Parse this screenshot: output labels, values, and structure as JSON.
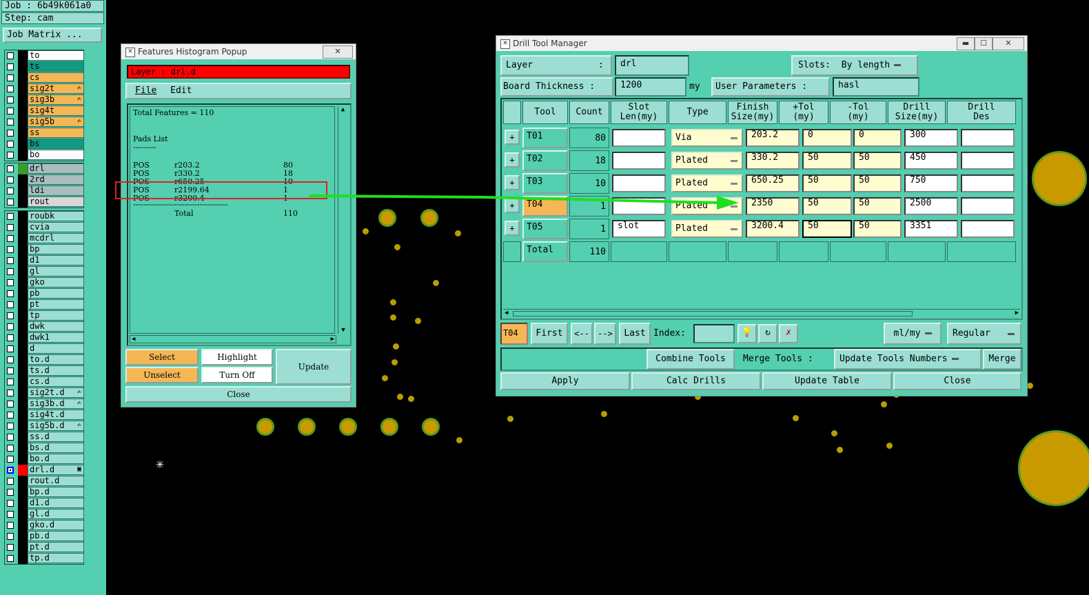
{
  "job_info": {
    "job": "Job : 6b49k061a0",
    "step": "Step: cam",
    "job_matrix": "Job Matrix ..."
  },
  "layers_top": [
    {
      "name": "to",
      "color": "#ffffff"
    },
    {
      "name": "ts",
      "color": "#129a83"
    },
    {
      "name": "cs",
      "color": "#f5b756"
    },
    {
      "name": "sig2t",
      "color": "#f5b756",
      "tick": true
    },
    {
      "name": "sig3b",
      "color": "#f5b756",
      "tick": true
    },
    {
      "name": "sig4t",
      "color": "#f5b756"
    },
    {
      "name": "sig5b",
      "color": "#f5b756",
      "tick": true
    },
    {
      "name": "ss",
      "color": "#f5b756"
    },
    {
      "name": "bs",
      "color": "#129a83"
    },
    {
      "name": "bo",
      "color": "#ffffff"
    }
  ],
  "layers_mid": [
    {
      "name": "drl",
      "color": "#a9bfbf",
      "swatch": "#3a9a2a"
    },
    {
      "name": "2rd",
      "color": "#a9bfbf"
    },
    {
      "name": "ldi",
      "color": "#a9bfbf"
    },
    {
      "name": "rout",
      "color": "#d8d8d8"
    }
  ],
  "layers_bottom": [
    {
      "name": "roubk"
    },
    {
      "name": "cvia"
    },
    {
      "name": "mcdrl"
    },
    {
      "name": "bp"
    },
    {
      "name": "d1"
    },
    {
      "name": "gl"
    },
    {
      "name": "gko"
    },
    {
      "name": "pb"
    },
    {
      "name": "pt"
    },
    {
      "name": "tp"
    },
    {
      "name": "dwk"
    },
    {
      "name": "dwk1"
    },
    {
      "name": "d"
    },
    {
      "name": "to.d"
    },
    {
      "name": "ts.d"
    },
    {
      "name": "cs.d"
    },
    {
      "name": "sig2t.d",
      "tick": true
    },
    {
      "name": "sig3b.d",
      "tick": true
    },
    {
      "name": "sig4t.d"
    },
    {
      "name": "sig5b.d",
      "tick": true
    },
    {
      "name": "ss.d"
    },
    {
      "name": "bs.d"
    },
    {
      "name": "bo.d"
    },
    {
      "name": "drl.d",
      "active": true
    },
    {
      "name": "rout.d"
    },
    {
      "name": "bp.d"
    },
    {
      "name": "d1.d"
    },
    {
      "name": "gl.d"
    },
    {
      "name": "gko.d"
    },
    {
      "name": "pb.d"
    },
    {
      "name": "pt.d"
    },
    {
      "name": "tp.d"
    }
  ],
  "histogram": {
    "title": "Features Histogram Popup",
    "close_x": "✕",
    "layer_label": "Layer :  drl.d",
    "menu_file": "File",
    "menu_edit": "Edit",
    "total_features": "Total Features = 110",
    "pads_list": "Pads List",
    "pads_underline": "---------",
    "rows": [
      {
        "kind": "POS",
        "sym": "r203.2",
        "count": "80"
      },
      {
        "kind": "POS",
        "sym": "r330.2",
        "count": "18"
      },
      {
        "kind": "POS",
        "sym": "r650.25",
        "count": "10"
      },
      {
        "kind": "POS",
        "sym": "r2199.64",
        "count": "1"
      },
      {
        "kind": "POS",
        "sym": "r3200.4",
        "count": "1"
      }
    ],
    "separator": "-------------------------------------",
    "total_label": "Total",
    "total_value": "110",
    "btn_select": "Select",
    "btn_highlight": "Highlight",
    "btn_update": "Update",
    "btn_unselect": "Unselect",
    "btn_turnoff": "Turn Off",
    "btn_close": "Close"
  },
  "dtm": {
    "title": "Drill Tool Manager",
    "layer_label": "Layer",
    "layer_colon": ":",
    "layer_value": "drl",
    "slots_label": "Slots:",
    "slots_value": "By length",
    "thickness_label": "Board Thickness :",
    "thickness_value": "1200",
    "thickness_unit": "my",
    "user_params_label": "User Parameters :",
    "user_params_value": "hasl",
    "headers": [
      "Tool",
      "Count",
      "Slot\nLen(my)",
      "Type",
      "Finish\nSize(my)",
      "+Tol\n(my)",
      "-Tol\n(my)",
      "Drill\nSize(my)",
      "Drill\nDes"
    ],
    "rows": [
      {
        "tool": "T01",
        "count": "80",
        "slot": "",
        "type": "Via",
        "finish": "203.2",
        "ptol": "0",
        "ntol": "0",
        "drill": "300",
        "des": ""
      },
      {
        "tool": "T02",
        "count": "18",
        "slot": "",
        "type": "Plated",
        "finish": "330.2",
        "ptol": "50",
        "ntol": "50",
        "drill": "450",
        "des": ""
      },
      {
        "tool": "T03",
        "count": "10",
        "slot": "",
        "type": "Plated",
        "finish": "650.25",
        "ptol": "50",
        "ntol": "50",
        "drill": "750",
        "des": ""
      },
      {
        "tool": "T04",
        "count": "1",
        "slot": "",
        "type": "Plated",
        "finish": "2350",
        "ptol": "50",
        "ntol": "50",
        "drill": "2500",
        "des": "",
        "selected": true
      },
      {
        "tool": "T05",
        "count": "1",
        "slot": "slot",
        "type": "Plated",
        "finish": "3200.4",
        "ptol": "50",
        "ntol": "50",
        "drill": "3351",
        "des": ""
      }
    ],
    "total_label": "Total",
    "total_count": "110",
    "current_tool": "T04",
    "nav_first": "First",
    "nav_prev": "<--",
    "nav_next": "-->",
    "nav_last": "Last",
    "index_label": "Index:",
    "units_value": "ml/my",
    "mode_value": "Regular",
    "btn_combine": "Combine Tools",
    "merge_label": "Merge Tools :",
    "merge_value": "Update Tools Numbers",
    "btn_merge": "Merge",
    "btn_apply": "Apply",
    "btn_calc": "Calc Drills",
    "btn_update_table": "Update Table",
    "btn_close": "Close"
  },
  "colors": {
    "panel": "#54cfb0",
    "button": "#9cded3",
    "orange": "#f5b756",
    "highlight_red": "#ff0000",
    "arrow_green": "#1ee01e",
    "pad": "#b89e00"
  }
}
